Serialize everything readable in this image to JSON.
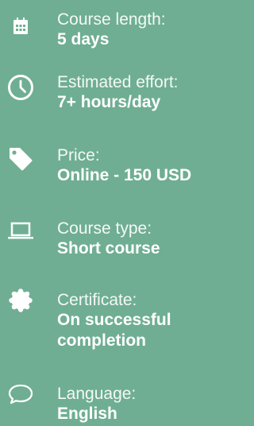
{
  "course_info": {
    "items": [
      {
        "icon": "calendar-icon",
        "label": "Course length:",
        "value": "5 days"
      },
      {
        "icon": "clock-icon",
        "label": "Estimated effort:",
        "value": "7+ hours/day"
      },
      {
        "icon": "price-tag-icon",
        "label": "Price:",
        "value": "Online - 150 USD"
      },
      {
        "icon": "laptop-icon",
        "label": "Course type:",
        "value": "Short course"
      },
      {
        "icon": "certificate-seal-icon",
        "label": "Certificate:",
        "value": "On successful completion"
      },
      {
        "icon": "speech-bubble-icon",
        "label": "Language:",
        "value": "English"
      }
    ]
  },
  "colors": {
    "background": "#6fae93",
    "text": "#ffffff"
  }
}
